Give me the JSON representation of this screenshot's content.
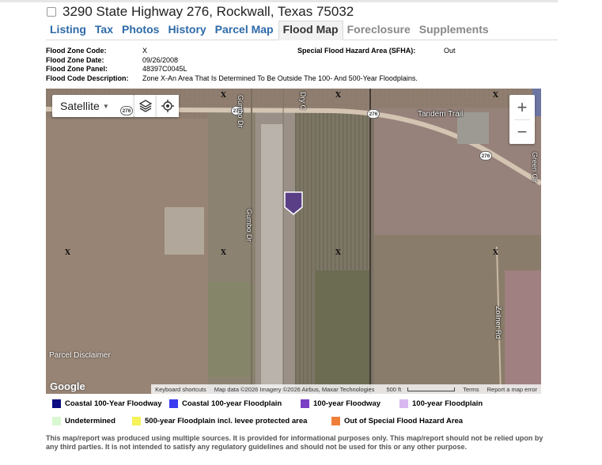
{
  "address": "3290 State Highway 276, Rockwall, Texas 75032",
  "tabs": [
    {
      "label": "Listing"
    },
    {
      "label": "Tax"
    },
    {
      "label": "Photos"
    },
    {
      "label": "History"
    },
    {
      "label": "Parcel Map"
    },
    {
      "label": "Flood Map"
    },
    {
      "label": "Foreclosure"
    },
    {
      "label": "Supplements"
    }
  ],
  "flood_info": {
    "zone_code_label": "Flood Zone Code:",
    "zone_code": "X",
    "zone_date_label": "Flood Zone Date:",
    "zone_date": "09/26/2008",
    "zone_panel_label": "Flood Zone Panel:",
    "zone_panel": "48397C0045L",
    "description_label": "Flood Code Description:",
    "description": "Zone X-An Area That Is Determined To Be Outside The 100- And 500-Year Floodplains.",
    "sfha_label": "Special Flood Hazard Area (SFHA):",
    "sfha_value": "Out"
  },
  "map": {
    "map_type_label": "Satellite",
    "zoom_in": "+",
    "zoom_out": "−",
    "labels": {
      "tandem_trail": "Tandem Trail",
      "gumbo_dr_north": "Gumbo Dr",
      "gumbo_dr_south": "Gumbo Dr",
      "dry_ct": "Dry C",
      "zollner_rd": "Zollner Rd",
      "green_cir": "Green Cir",
      "highway_shield": "276",
      "zone_marker": "X"
    },
    "parcel_disclaimer": "Parcel Disclaimer",
    "google_logo": "Google",
    "attribution": {
      "shortcuts": "Keyboard shortcuts",
      "map_data": "Map data ©2026 Imagery ©2026 Airbus, Maxar Technologies",
      "scale": "500 ft",
      "terms": "Terms",
      "report": "Report a map error"
    }
  },
  "legend": [
    {
      "label": "Coastal 100-Year Floodway",
      "color": "#0c0c80"
    },
    {
      "label": "Coastal 100-year Floodplain",
      "color": "#3a3af0"
    },
    {
      "label": "100-year Floodway",
      "color": "#7a3fc2"
    },
    {
      "label": "100-year Floodplain",
      "color": "#d9b8f2"
    },
    {
      "label": "Undetermined",
      "color": "#d9f7d0"
    },
    {
      "label": "500-year Floodplain incl. levee protected area",
      "color": "#f5f25a"
    },
    {
      "label": "Out of Special Flood Hazard Area",
      "color": "#f07f3a"
    }
  ],
  "disclaimer": "This map/report was produced using multiple sources. It is provided for informational purposes only. This map/report should not be relied upon by any third parties. It is not intended to satisfy any regulatory guidelines and should not be used for this or any other purpose."
}
